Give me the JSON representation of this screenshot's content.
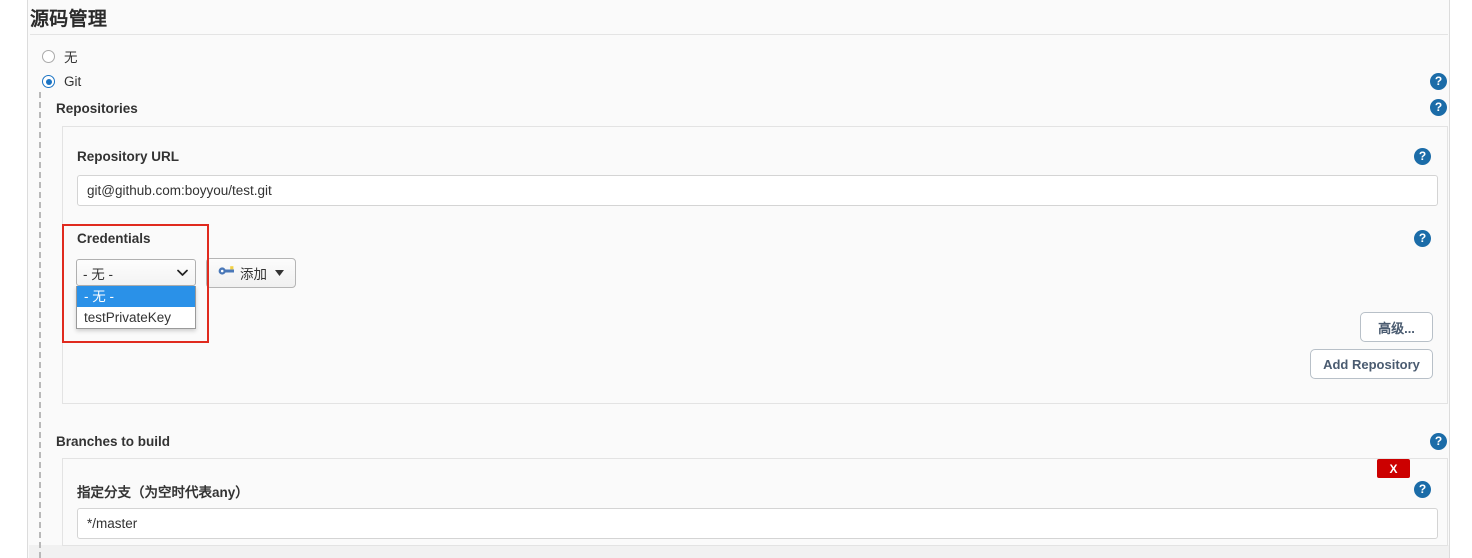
{
  "section": {
    "title": "源码管理"
  },
  "scm_options": [
    {
      "label": "无",
      "selected": false,
      "name": "scm-none"
    },
    {
      "label": "Git",
      "selected": true,
      "name": "scm-git"
    }
  ],
  "repositories": {
    "group_label": "Repositories",
    "repository_url": {
      "label": "Repository URL",
      "value": "git@github.com:boyyou/test.git",
      "placeholder": ""
    },
    "credentials": {
      "label": "Credentials",
      "selected": "- 无 -",
      "options": [
        "- 无 -",
        "testPrivateKey"
      ],
      "highlighted_option": "- 无 -",
      "add_button_label": "添加",
      "add_button_icon": "key-icon",
      "dropdown_open": true,
      "highlight_color": "#e02a1e"
    },
    "advanced_button_label": "高级...",
    "add_repository_button_label": "Add Repository"
  },
  "branches": {
    "group_label": "Branches to build",
    "branch_specifier": {
      "label": "指定分支（为空时代表any）",
      "value": "*/master",
      "placeholder": ""
    },
    "delete_button_label": "X"
  },
  "help_icons": {
    "glyph": "?",
    "color": "#1b6ca8",
    "items": [
      "help-repositories-group",
      "help-repositories",
      "help-repository-url",
      "help-credentials",
      "help-branches-to-build",
      "help-branch-specifier"
    ]
  },
  "colors": {
    "accent": "#1b74c4",
    "select_highlight": "#2a91e8",
    "danger": "#cc0000",
    "panel_bg": "#fafafa"
  }
}
